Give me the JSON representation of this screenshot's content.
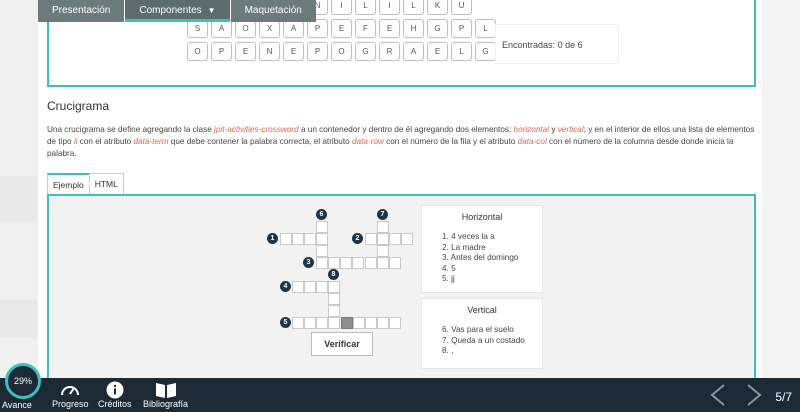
{
  "nav": {
    "tabs": [
      {
        "label": "Presentación"
      },
      {
        "label": "Componentes"
      },
      {
        "label": "Maquetación"
      }
    ]
  },
  "wordsearch": {
    "rows": [
      [
        "",
        "",
        "",
        "",
        "U",
        "N",
        "I",
        "L",
        "I",
        "L",
        "K",
        "U"
      ],
      [
        "S",
        "A",
        "O",
        "X",
        "A",
        "P",
        "E",
        "F",
        "E",
        "H",
        "G",
        "P",
        "L"
      ],
      [
        "O",
        "P",
        "E",
        "N",
        "E",
        "P",
        "O",
        "G",
        "R",
        "A",
        "E",
        "L",
        "G"
      ]
    ],
    "found_label": "Encontradas:",
    "found_value": "0 de 6"
  },
  "section": {
    "title": "Crucigrama",
    "desc_1": "Una crucigrama se define agregando la clase ",
    "desc_class": "jpit-activities-crossword",
    "desc_2": " a un contenedor y dentro de él agregando dos elementos: ",
    "desc_horizontal": "horizontal",
    "desc_3": " y ",
    "desc_vertical": "vertical",
    "desc_4": "; y en el interior de ellos una lista de elementos de tipo ",
    "desc_li": "li",
    "desc_5": " con el atributo ",
    "desc_term": "data-term",
    "desc_6": " que debe contener la palabra correcta, el atributo ",
    "desc_row": "data-row",
    "desc_7": " con el número de la fila y el atributo ",
    "desc_col": "data-col",
    "desc_8": " con el número de la columna desde donde inicia la palabra."
  },
  "example_tabs": {
    "ejemplo": "Ejemplo",
    "html": "HTML"
  },
  "crossword": {
    "numbers": [
      "1",
      "2",
      "3",
      "4",
      "5",
      "6",
      "7",
      "8"
    ],
    "verify_label": "Verificar",
    "horizontal_title": "Horizontal",
    "horizontal": [
      "1. 4 veces la a",
      "2. La madre",
      "3. Antes del domingo",
      "4. 5",
      "5. jj"
    ],
    "vertical_title": "Vertical",
    "vertical": [
      "6. Vas para el suelo",
      "7. Queda a un costado",
      "8. ,"
    ]
  },
  "bottom": {
    "progress": "29%",
    "avance": "Avance",
    "progreso": "Progreso",
    "creditos": "Créditos",
    "bibliografia": "Bibliografía",
    "page": "5/7"
  },
  "colors": {
    "accent": "#3cbfc1",
    "bar": "#1b2a35",
    "nav": "#6b7b79",
    "highlight": "#d9674f"
  }
}
